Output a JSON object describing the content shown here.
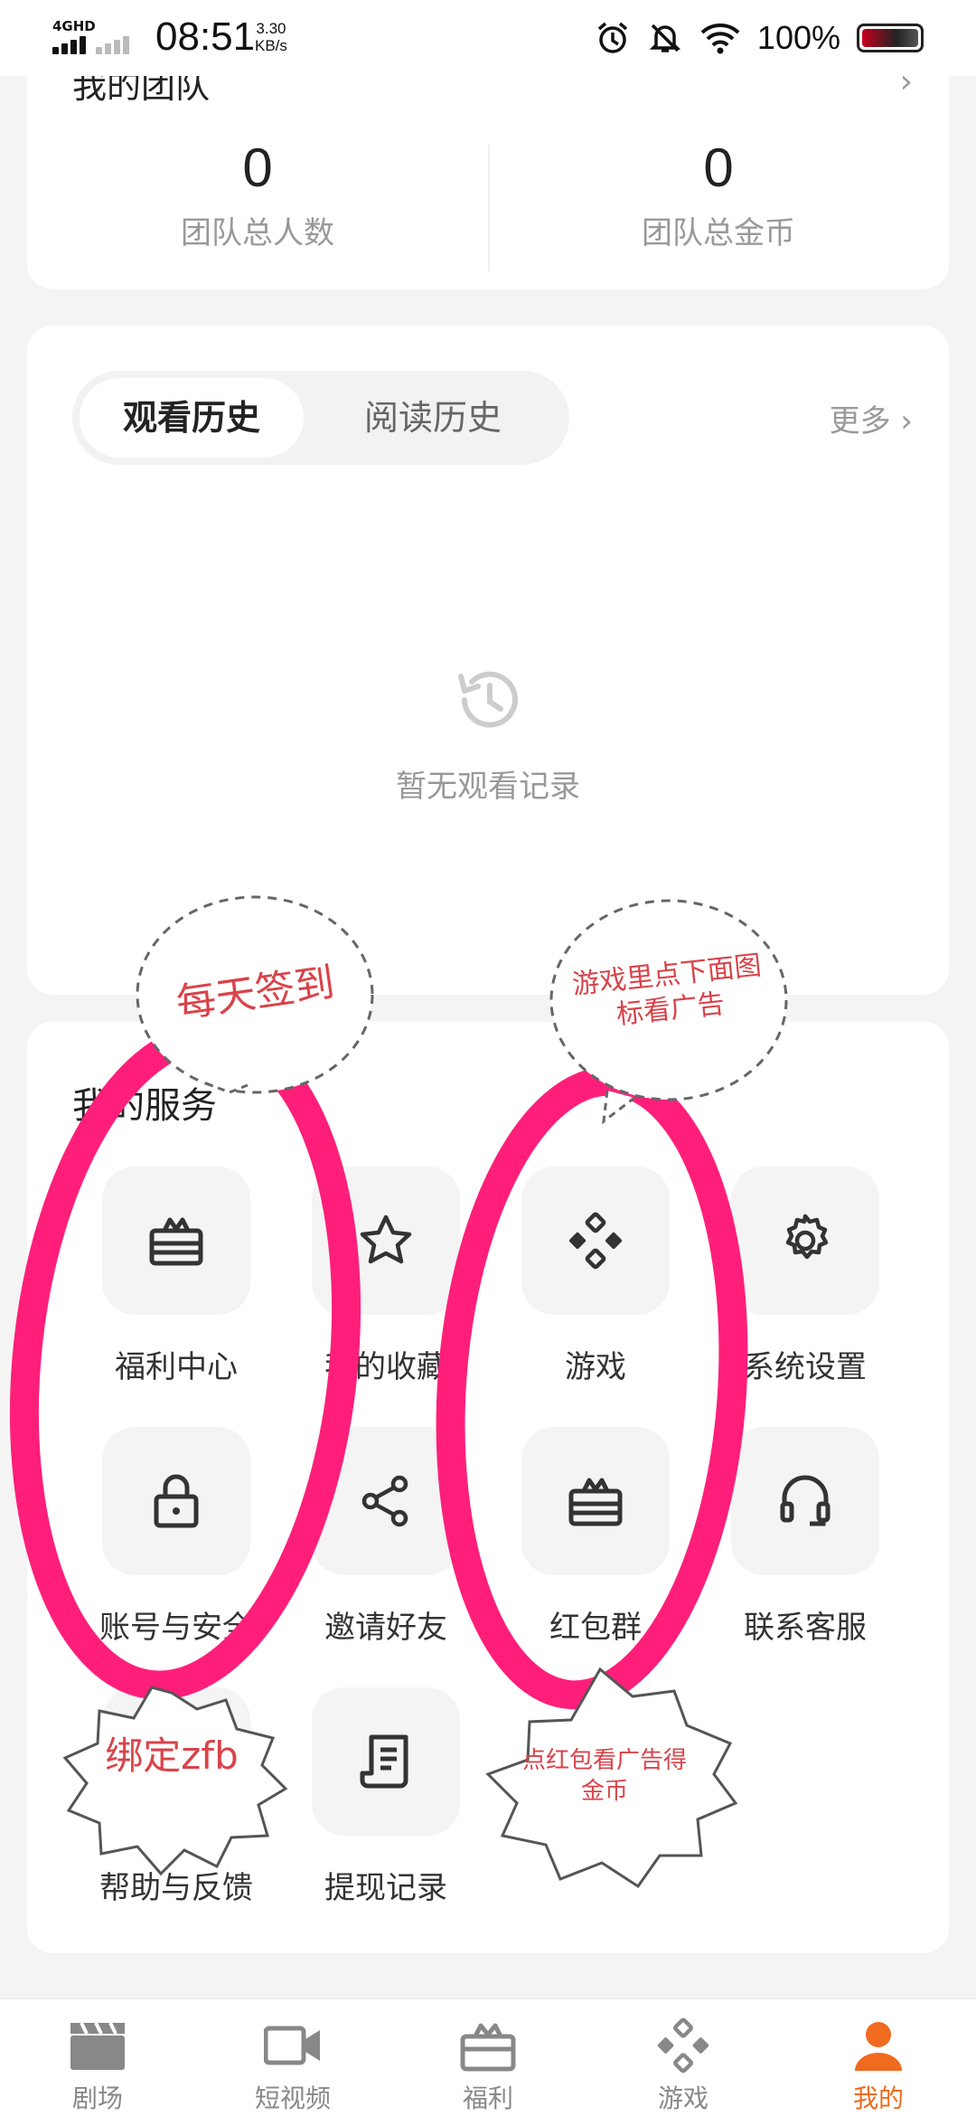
{
  "status_bar": {
    "network": "4GHD",
    "time": "08:51",
    "speed_value": "3.30",
    "speed_unit": "KB/s",
    "battery": "100%"
  },
  "team": {
    "title": "我的团队",
    "stats": [
      {
        "value": "0",
        "label": "团队总人数"
      },
      {
        "value": "0",
        "label": "团队总金币"
      }
    ]
  },
  "history": {
    "tabs": [
      {
        "label": "观看历史",
        "active": true
      },
      {
        "label": "阅读历史",
        "active": false
      }
    ],
    "more_label": "更多",
    "empty_text": "暂无观看记录"
  },
  "services": {
    "title": "我的服务",
    "items": [
      {
        "label": "福利中心",
        "icon": "gift-box-icon"
      },
      {
        "label": "我的收藏",
        "icon": "star-icon"
      },
      {
        "label": "游戏",
        "icon": "gamepad-icon"
      },
      {
        "label": "系统设置",
        "icon": "gear-icon"
      },
      {
        "label": "账号与安全",
        "icon": "lock-icon"
      },
      {
        "label": "邀请好友",
        "icon": "share-icon"
      },
      {
        "label": "红包群",
        "icon": "gift-box-icon"
      },
      {
        "label": "联系客服",
        "icon": "headset-icon"
      },
      {
        "label": "帮助与反馈",
        "icon": "help-icon"
      },
      {
        "label": "提现记录",
        "icon": "receipt-icon"
      }
    ]
  },
  "annotations": [
    {
      "text": "每天签到"
    },
    {
      "text": "游戏里点下面图标看广告"
    },
    {
      "text": "绑定zfb"
    },
    {
      "text": "点红包看广告得金币"
    }
  ],
  "bottom_nav": {
    "items": [
      {
        "label": "剧场",
        "icon": "clapperboard-icon",
        "active": false
      },
      {
        "label": "短视频",
        "icon": "video-camera-icon",
        "active": false
      },
      {
        "label": "福利",
        "icon": "gift-box-icon",
        "active": false
      },
      {
        "label": "游戏",
        "icon": "gamepad-icon",
        "active": false
      },
      {
        "label": "我的",
        "icon": "person-icon",
        "active": true
      }
    ]
  },
  "colors": {
    "accent": "#f06a1f",
    "annotation_stroke": "#ff1f7a",
    "annotation_text": "#d9434a"
  }
}
